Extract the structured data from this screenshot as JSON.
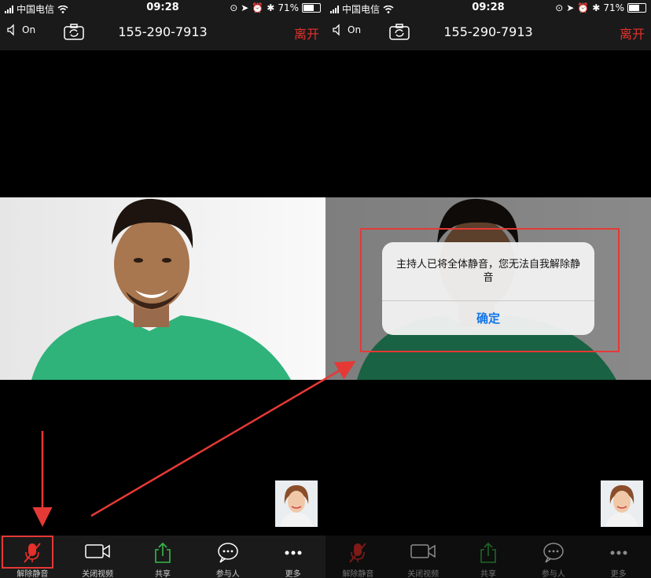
{
  "status_bar": {
    "carrier": "中国电信",
    "time": "09:28",
    "battery_percent": "71%",
    "battery_level": 0.71
  },
  "top_bar": {
    "speaker_label": "On",
    "meeting_number": "155-290-7913",
    "leave_label": "离开"
  },
  "toolbar": {
    "items": [
      {
        "label": "解除静音",
        "icon": "mic-muted-icon",
        "color": "#e8302b"
      },
      {
        "label": "关闭视频",
        "icon": "video-camera-icon",
        "color": "#ffffff"
      },
      {
        "label": "共享",
        "icon": "share-icon",
        "color": "#38b84a"
      },
      {
        "label": "参与人",
        "icon": "participants-icon",
        "color": "#ffffff"
      },
      {
        "label": "更多",
        "icon": "more-icon",
        "color": "#ffffff"
      }
    ]
  },
  "dialog": {
    "message": "主持人已将全体静音，您无法自我解除静音",
    "confirm_label": "确定"
  },
  "colors": {
    "accent_red": "#e8302b",
    "link_blue": "#1275e8",
    "annotation_red": "#e53935"
  }
}
